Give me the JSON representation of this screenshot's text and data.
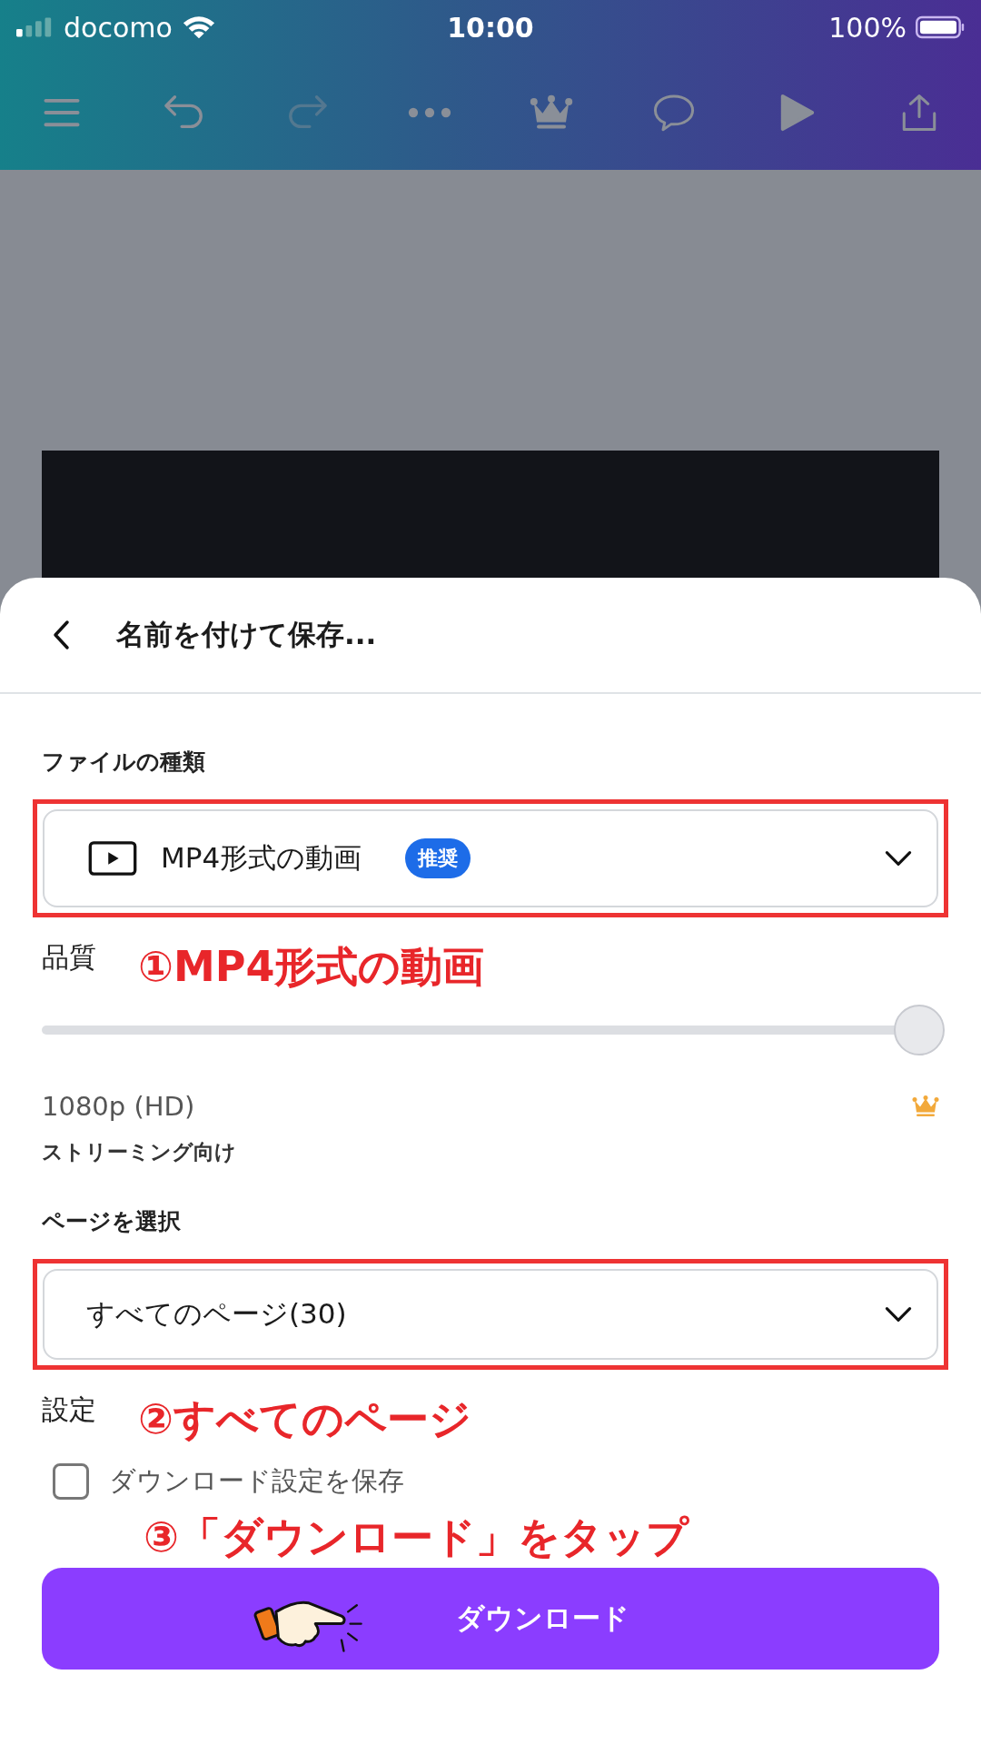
{
  "status_bar": {
    "carrier": "docomo",
    "time": "10:00",
    "battery": "100%"
  },
  "toolbar": {
    "undo": {
      "disabled": false
    },
    "redo": {
      "disabled": true
    }
  },
  "sheet": {
    "title": "名前を付けて保存...",
    "file_type": {
      "label": "ファイルの種類",
      "value": "MP4形式の動画",
      "badge": "推奨"
    },
    "quality": {
      "label": "品質",
      "level": 1,
      "resolution": "1080p (HD)",
      "note": "ストリーミング向け"
    },
    "pages": {
      "label": "ページを選択",
      "value": "すべてのページ(30)"
    },
    "settings": {
      "label": "設定",
      "checkbox": {
        "label": "ダウンロード設定を保存",
        "checked": false
      }
    },
    "download_button": "ダウンロード"
  },
  "annotations": [
    "①MP4形式の動画",
    "②すべてのページ",
    "③「ダウンロード」をタップ"
  ]
}
